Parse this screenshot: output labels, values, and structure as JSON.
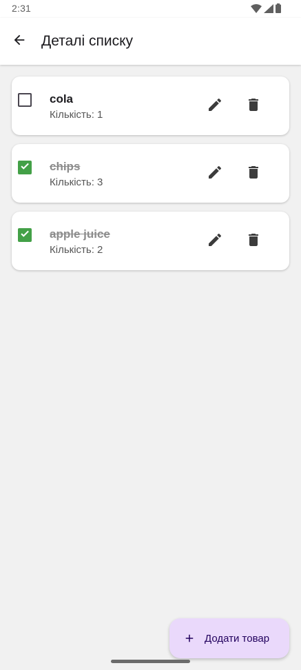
{
  "status_bar": {
    "time": "2:31",
    "icons": [
      "wifi-icon",
      "signal-icon",
      "battery-icon"
    ]
  },
  "app_bar": {
    "back_icon": "arrow-back-icon",
    "title": "Деталі списку"
  },
  "items": [
    {
      "name": "cola",
      "quantity_text": "Кількість: 1",
      "checked": false
    },
    {
      "name": "chips",
      "quantity_text": "Кількість: 3",
      "checked": true
    },
    {
      "name": "apple juice",
      "quantity_text": "Кількість: 2",
      "checked": true
    }
  ],
  "item_actions": {
    "edit_icon": "pencil-icon",
    "delete_icon": "trash-icon"
  },
  "fab": {
    "icon": "plus-icon",
    "label": "Додати товар"
  },
  "colors": {
    "checkbox_checked": "#43a047",
    "fab_background": "#ead9fb",
    "fab_text": "#21005d",
    "background": "#f1f1f1"
  }
}
